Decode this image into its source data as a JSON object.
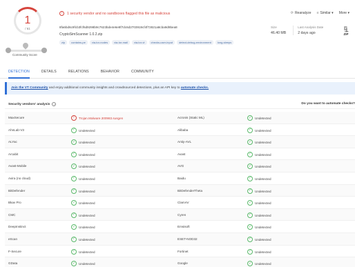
{
  "summary": {
    "score": "1",
    "score_total": "/ 61",
    "community_label": "Community Score",
    "alert": "1 security vendor and no sandboxes flagged this file as malicious",
    "hash": "8fa6bd6c9fcb3fcf6d9298b9c7623bde4e6e8f7dc6d2703919cf4f72821a8cba9d9bea8",
    "filename": "CryptoSimScanner 1.0.2.zip",
    "tags": [
      "zip",
      "contains-pe",
      "via-tor-nodes",
      "via-tor-mail",
      "via-tor-vt",
      "checks-user-input",
      "detect-debug-environment",
      "long-sleeps"
    ],
    "actions": {
      "reanalyze": "Reanalyze",
      "similar": "Similar",
      "more": "More"
    },
    "size_label": "Size",
    "size_value": "46.40 MB",
    "last_label": "Last Analysis Date",
    "last_value": "2 days ago",
    "filetype": "ZIP"
  },
  "tabs": [
    "DETECTION",
    "DETAILS",
    "RELATIONS",
    "BEHAVIOR",
    "COMMUNITY"
  ],
  "banner": {
    "link1": "Join the VT Community",
    "text": " and enjoy additional community insights and crowdsourced detections, plus an API key to ",
    "link2": "automate checks."
  },
  "section": {
    "title": "Security vendors' analysis",
    "right": "Do you want to automate checks?"
  },
  "rows": [
    {
      "v1": "MaxSecure",
      "d1": "Trojan.Malware.300983.susgen",
      "bad1": true,
      "v2": "Acronis (Static ML)",
      "d2": "Undetected"
    },
    {
      "v1": "AhnLab-V3",
      "d1": "Undetected",
      "bad1": false,
      "v2": "Alibaba",
      "d2": "Undetected"
    },
    {
      "v1": "ALYac",
      "d1": "Undetected",
      "bad1": false,
      "v2": "Antiy-AVL",
      "d2": "Undetected"
    },
    {
      "v1": "Arcabit",
      "d1": "Undetected",
      "bad1": false,
      "v2": "Avast",
      "d2": "Undetected"
    },
    {
      "v1": "Avast-Mobile",
      "d1": "Undetected",
      "bad1": false,
      "v2": "AVG",
      "d2": "Undetected"
    },
    {
      "v1": "Avira (no cloud)",
      "d1": "Undetected",
      "bad1": false,
      "v2": "Baidu",
      "d2": "Undetected"
    },
    {
      "v1": "BitDefender",
      "d1": "Undetected",
      "bad1": false,
      "v2": "BitDefenderTheta",
      "d2": "Undetected"
    },
    {
      "v1": "Bkav Pro",
      "d1": "Undetected",
      "bad1": false,
      "v2": "ClamAV",
      "d2": "Undetected"
    },
    {
      "v1": "CMC",
      "d1": "Undetected",
      "bad1": false,
      "v2": "Cyren",
      "d2": "Undetected"
    },
    {
      "v1": "DeepInstinct",
      "d1": "Undetected",
      "bad1": false,
      "v2": "Emsisoft",
      "d2": "Undetected"
    },
    {
      "v1": "eScan",
      "d1": "Undetected",
      "bad1": false,
      "v2": "ESET-NOD32",
      "d2": "Undetected"
    },
    {
      "v1": "F-Secure",
      "d1": "Undetected",
      "bad1": false,
      "v2": "Fortinet",
      "d2": "Undetected"
    },
    {
      "v1": "GData",
      "d1": "Undetected",
      "bad1": false,
      "v2": "Google",
      "d2": "Undetected"
    }
  ],
  "colors": {
    "accent": "#2f6fd6",
    "malicious": "#d6453d",
    "clean": "#5ab96a"
  }
}
